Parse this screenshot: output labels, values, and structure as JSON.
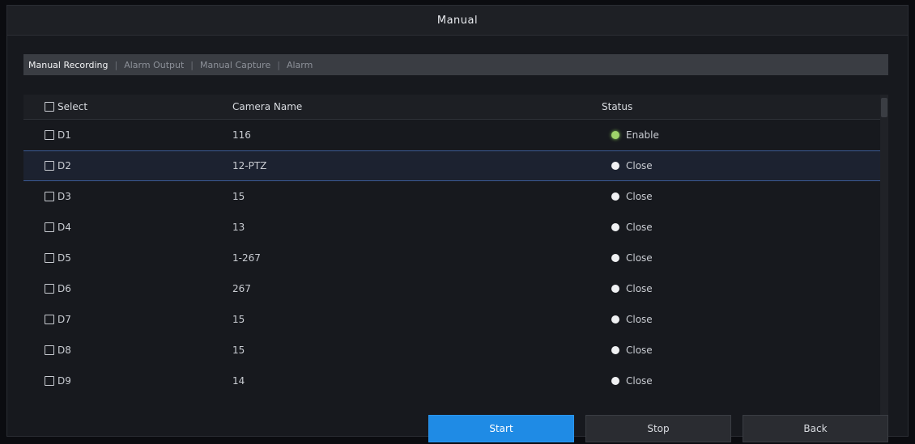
{
  "window": {
    "title": "Manual"
  },
  "tabs": [
    {
      "label": "Manual Recording",
      "active": true
    },
    {
      "label": "Alarm Output",
      "active": false
    },
    {
      "label": "Manual Capture",
      "active": false
    },
    {
      "label": "Alarm",
      "active": false
    }
  ],
  "table": {
    "columns": {
      "select": "Select",
      "name": "Camera Name",
      "status": "Status"
    },
    "rows": [
      {
        "id": "D1",
        "name": "116",
        "status": "Enable",
        "status_color": "#9fd36a"
      },
      {
        "id": "D2",
        "name": "12-PTZ",
        "status": "Close",
        "status_color": "#f0f1f3"
      },
      {
        "id": "D3",
        "name": "15",
        "status": "Close",
        "status_color": "#f0f1f3"
      },
      {
        "id": "D4",
        "name": "13",
        "status": "Close",
        "status_color": "#f0f1f3"
      },
      {
        "id": "D5",
        "name": "1-267",
        "status": "Close",
        "status_color": "#f0f1f3"
      },
      {
        "id": "D6",
        "name": "267",
        "status": "Close",
        "status_color": "#f0f1f3"
      },
      {
        "id": "D7",
        "name": "15",
        "status": "Close",
        "status_color": "#f0f1f3"
      },
      {
        "id": "D8",
        "name": "15",
        "status": "Close",
        "status_color": "#f0f1f3"
      },
      {
        "id": "D9",
        "name": "14",
        "status": "Close",
        "status_color": "#f0f1f3"
      }
    ]
  },
  "buttons": {
    "primary": "Start",
    "secondary": "Stop",
    "tertiary": "Back"
  },
  "colors": {
    "accent": "#1f8be5",
    "selection_border": "#3b5a93",
    "enabled": "#9fd36a"
  }
}
